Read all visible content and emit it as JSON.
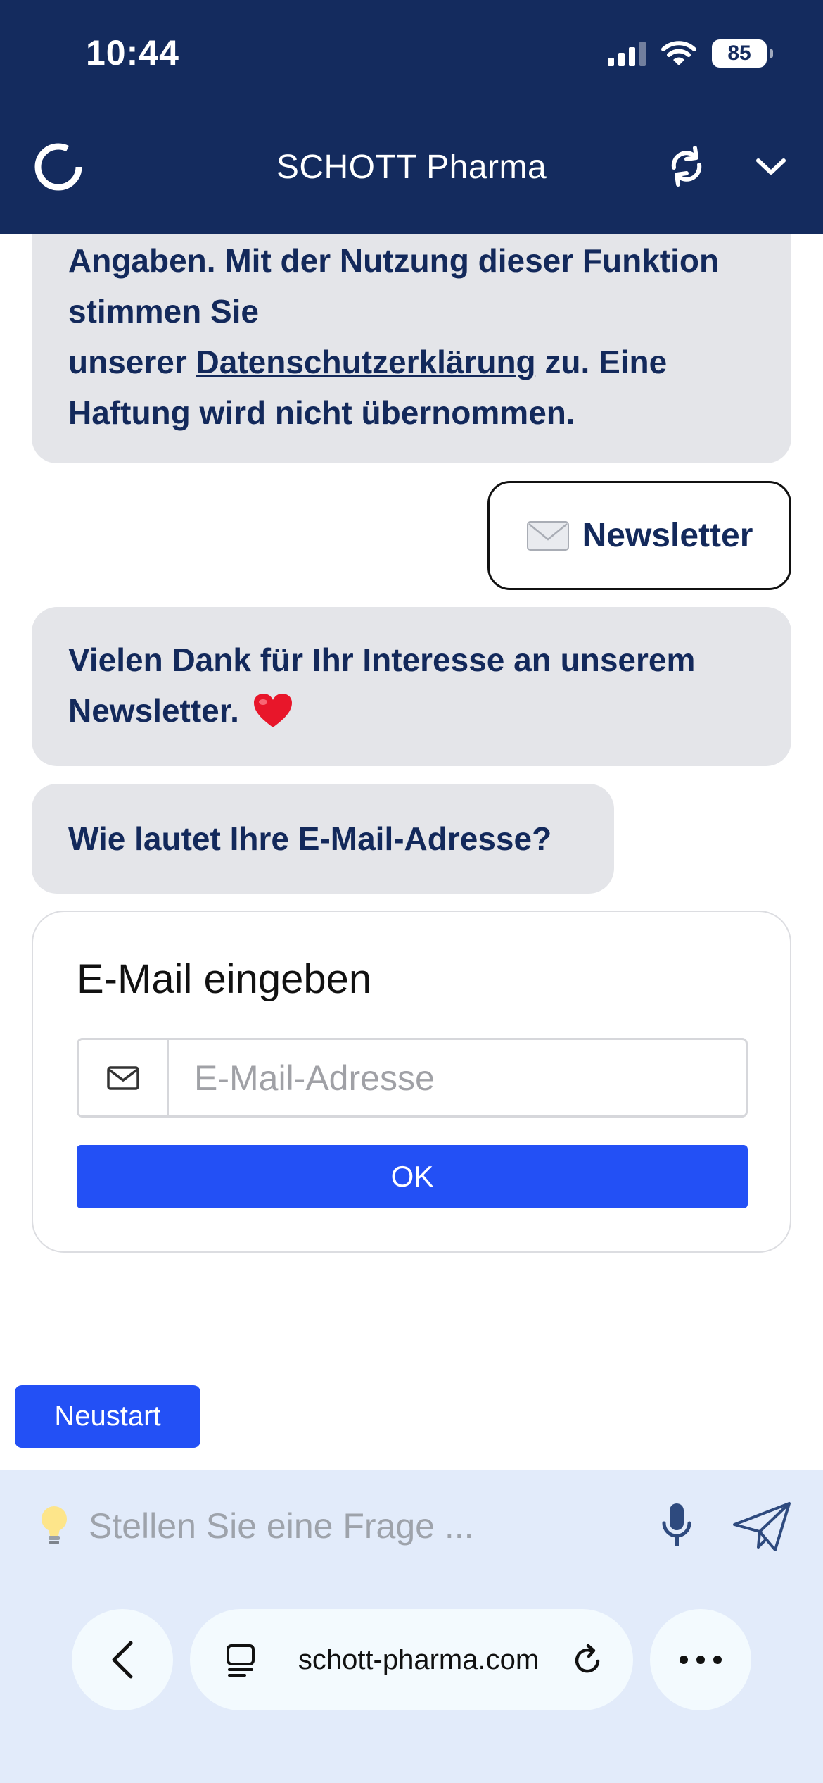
{
  "status_bar": {
    "time": "10:44",
    "battery": "85"
  },
  "header": {
    "title": "SCHOTT Pharma",
    "background": "#142b5e"
  },
  "chat": {
    "disclaimer": {
      "line1": "Angaben. Mit der Nutzung dieser Funktion",
      "line2": "stimmen Sie",
      "line3_prefix": "unserer ",
      "link": "Datenschutzerklärung",
      "line3_suffix": " zu. Eine",
      "line4": "Haftung wird nicht übernommen."
    },
    "user_choice": {
      "emoji": "envelope-icon",
      "label": "Newsletter"
    },
    "thanks": {
      "text": "Vielen Dank für Ihr Interesse an unserem Newsletter.",
      "emoji": "heart-icon"
    },
    "question": "Wie lautet Ihre E-Mail-Adresse?",
    "email_card": {
      "title": "E-Mail eingeben",
      "placeholder": "E-Mail-Adresse",
      "value": "",
      "ok_label": "OK"
    }
  },
  "restart_label": "Neustart",
  "composer": {
    "placeholder": "Stellen Sie eine Frage ..."
  },
  "browser": {
    "url": "schott-pharma.com"
  },
  "colors": {
    "accent": "#2350f5",
    "bubble": "#e4e5e9",
    "text": "#13295b",
    "composer_bg": "#e2ebfa"
  }
}
